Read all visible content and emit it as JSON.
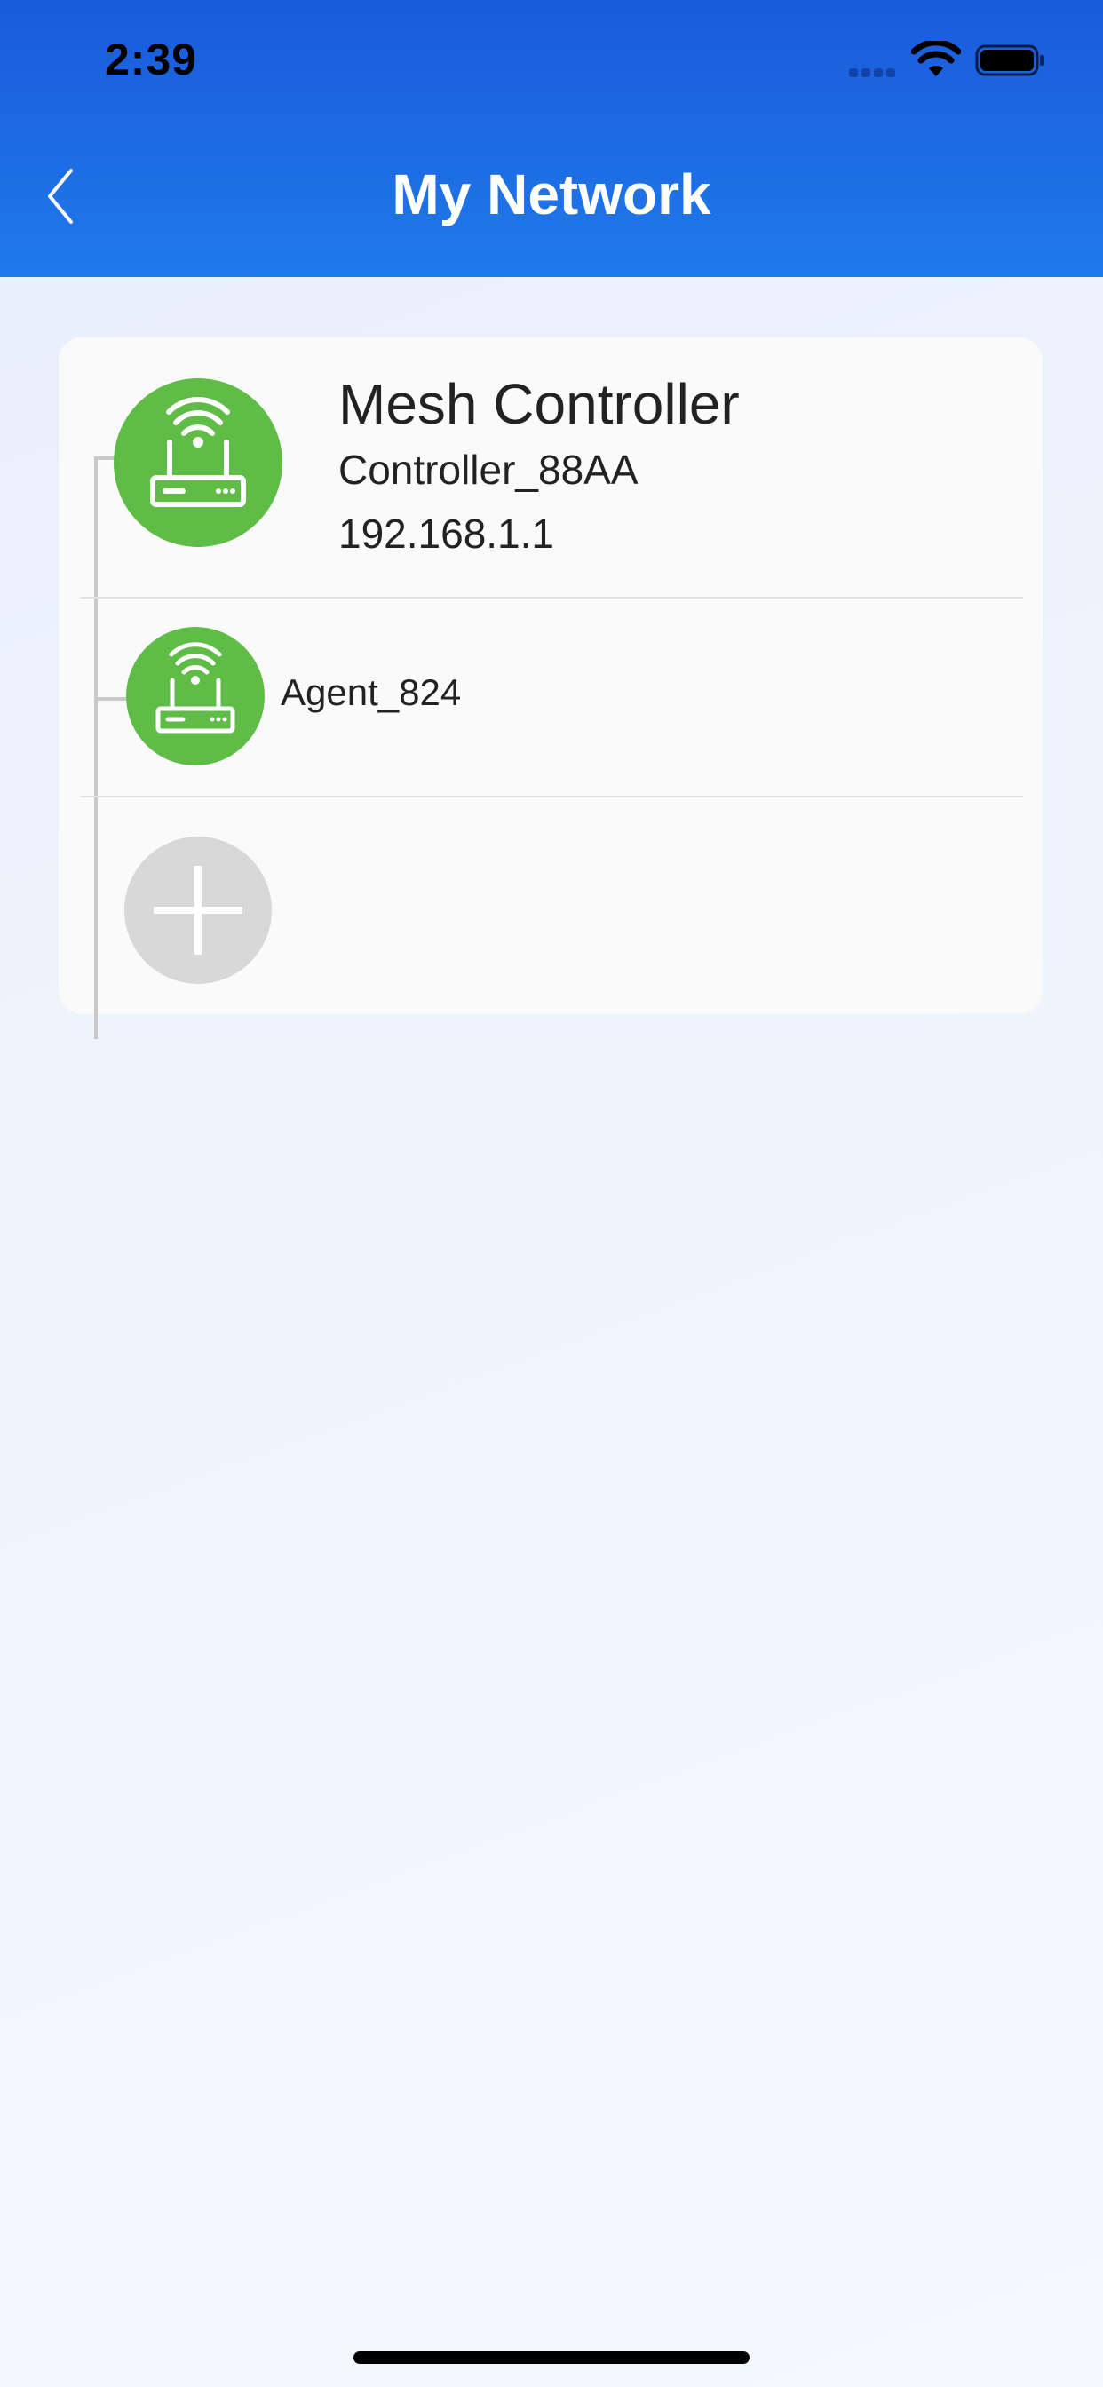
{
  "status_bar": {
    "time": "2:39"
  },
  "header": {
    "title": "My Network",
    "back_icon": "chevron-left-icon"
  },
  "network": {
    "controller": {
      "type_label": "Mesh Controller",
      "name": "Controller_88AA",
      "ip": "192.168.1.1",
      "icon": "router-icon",
      "icon_color": "#5fbc47"
    },
    "agents": [
      {
        "name": "Agent_824",
        "icon": "router-icon",
        "icon_color": "#5fbc47"
      }
    ],
    "add_icon": "plus-icon"
  },
  "colors": {
    "header_top": "#1a5adc",
    "header_bottom": "#1f7ae9",
    "card_background": "#fafafa",
    "add_button": "#d8d8d8"
  }
}
